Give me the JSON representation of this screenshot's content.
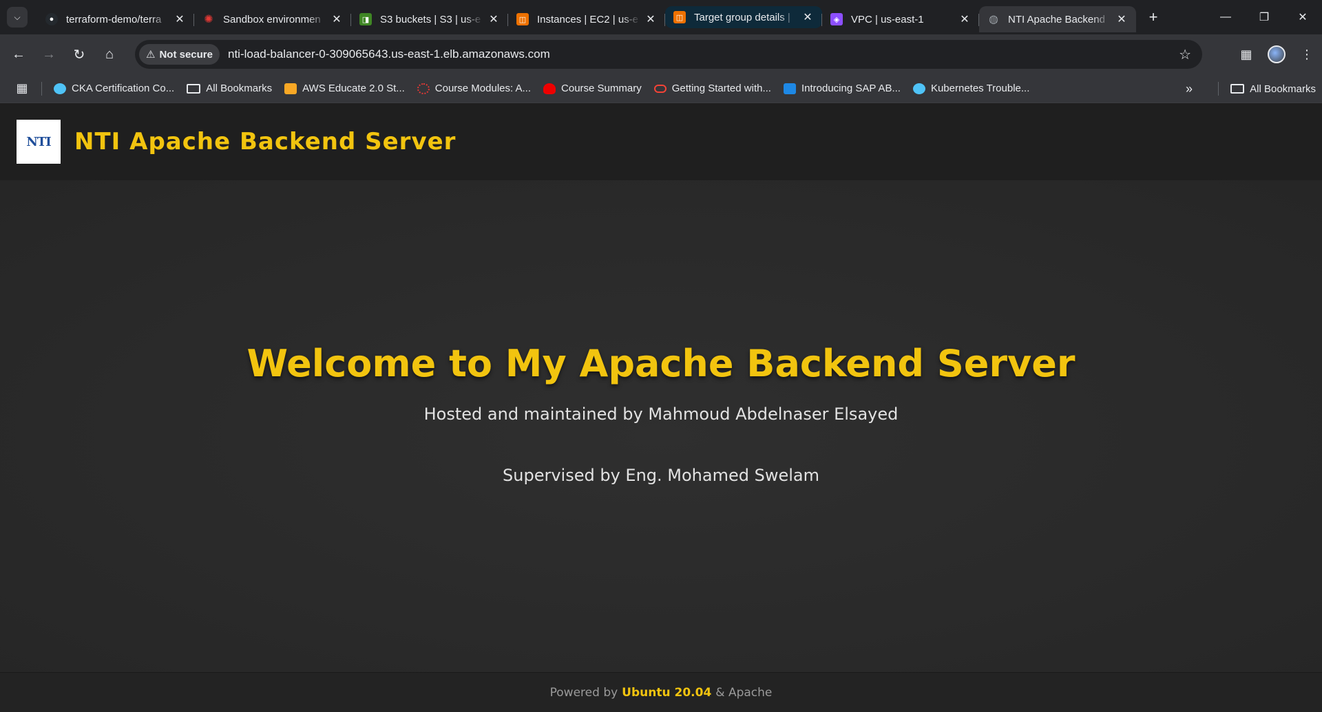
{
  "browser": {
    "tabs": [
      {
        "title": "terraform-demo/terra",
        "icon": "github-icon",
        "color": "#e8eaed"
      },
      {
        "title": "Sandbox environmen",
        "icon": "redhat-gear-icon",
        "color": "#e53935"
      },
      {
        "title": "S3 buckets | S3 | us-e",
        "icon": "s3-icon",
        "color": "#3f8624"
      },
      {
        "title": "Instances | EC2 | us-e",
        "icon": "ec2-icon",
        "color": "#ed7100"
      },
      {
        "title": "Target group details |",
        "icon": "ec2-icon",
        "color": "#ed7100"
      },
      {
        "title": "VPC | us-east-1",
        "icon": "vpc-icon",
        "color": "#8c4fff"
      },
      {
        "title": "NTI Apache Backend",
        "icon": "globe-icon",
        "color": "#9aa0a6"
      }
    ],
    "omnibox": {
      "security_label": "Not secure",
      "url": "nti-load-balancer-0-309065643.us-east-1.elb.amazonaws.com"
    },
    "bookmarks": [
      {
        "label": "CKA Certification Co...",
        "icon": "cloud-icon",
        "color": "#4fc3f7"
      },
      {
        "label": "All Bookmarks",
        "icon": "folder-icon",
        "color": "#e8eaed"
      },
      {
        "label": "AWS Educate 2.0 St...",
        "icon": "box-icon",
        "color": "#f9a825"
      },
      {
        "label": "Course Modules: A...",
        "icon": "redhat-gear-icon",
        "color": "#e53935"
      },
      {
        "label": "Course Summary",
        "icon": "redhat-icon",
        "color": "#ee0000"
      },
      {
        "label": "Getting Started with...",
        "icon": "oracle-icon",
        "color": "#f44336"
      },
      {
        "label": "Introducing SAP AB...",
        "icon": "sap-icon",
        "color": "#1e88e5"
      },
      {
        "label": "Kubernetes Trouble...",
        "icon": "cloud-icon",
        "color": "#4fc3f7"
      }
    ],
    "bookmarks_right": "All Bookmarks"
  },
  "site": {
    "logo_text": "NTI",
    "header_title": "NTI Apache Backend Server",
    "welcome": "Welcome to My Apache Backend Server",
    "hosted_by": "Hosted and maintained by Mahmoud Abdelnaser Elsayed",
    "supervised_by": "Supervised by Eng. Mohamed Swelam",
    "footer": {
      "prefix": "Powered by",
      "highlight": "Ubuntu 20.04",
      "suffix": "& Apache"
    },
    "accent_color": "#f2c40f"
  }
}
